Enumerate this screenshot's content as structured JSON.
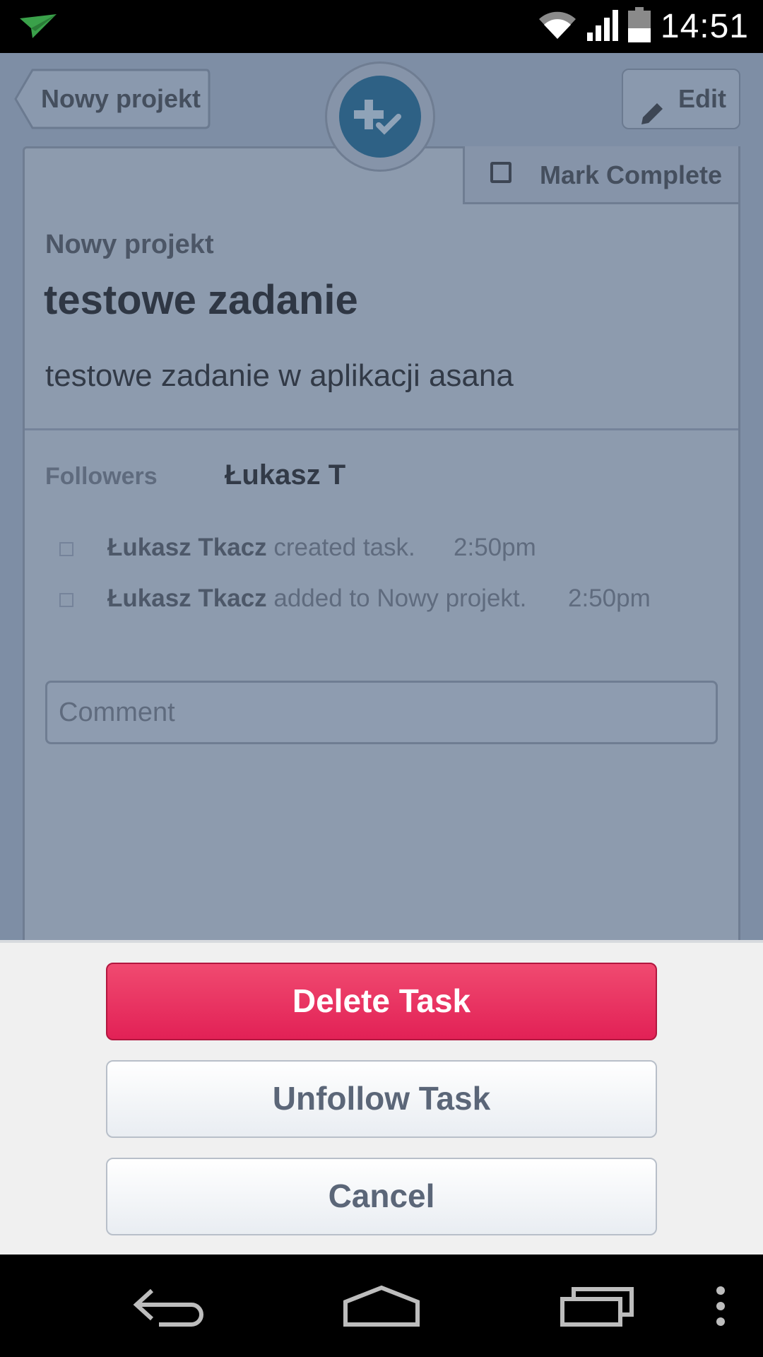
{
  "status_bar": {
    "time": "14:51",
    "icons": [
      "app-notification-icon",
      "wifi-icon",
      "cell-signal-icon",
      "battery-icon"
    ]
  },
  "header": {
    "back_label": "Nowy projekt",
    "edit_label": "Edit",
    "fab_icon": "add-task-icon"
  },
  "task": {
    "mark_complete_label": "Mark Complete",
    "project": "Nowy projekt",
    "title": "testowe zadanie",
    "description": "testowe zadanie w aplikacji asana",
    "followers_label": "Followers",
    "followers_value": "Łukasz T"
  },
  "activity": [
    {
      "user": "Łukasz Tkacz",
      "action": " created task.",
      "time": "2:50pm"
    },
    {
      "user": "Łukasz Tkacz",
      "action": " added to Nowy projekt.",
      "time": "2:50pm"
    }
  ],
  "comment": {
    "placeholder": "Comment"
  },
  "action_sheet": {
    "delete_label": "Delete Task",
    "unfollow_label": "Unfollow Task",
    "cancel_label": "Cancel"
  },
  "nav_bar": {
    "icons": [
      "back-icon",
      "home-icon",
      "recent-apps-icon",
      "overflow-menu-icon"
    ]
  },
  "colors": {
    "delete": "#e8285a",
    "overlay": "#7e8ea5",
    "fab": "#2e6185",
    "sheet": "#f0f0f0"
  }
}
